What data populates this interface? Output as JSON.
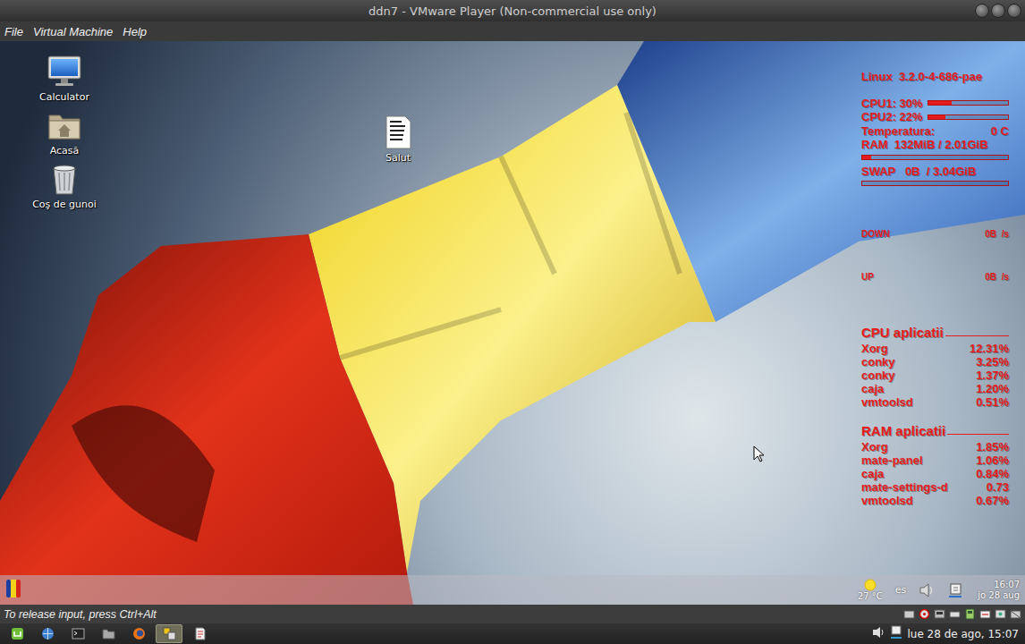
{
  "window": {
    "title": "ddn7 - VMware Player (Non-commercial use only)"
  },
  "menu": [
    "File",
    "Virtual Machine",
    "Help"
  ],
  "desktop_icons": [
    {
      "label": "Calculator"
    },
    {
      "label": "Acasă"
    },
    {
      "label": "Coş de gunoi"
    },
    {
      "label": "Salut"
    }
  ],
  "conky": {
    "kernel": "Linux  3.2.0-4-686-pae",
    "system": [
      {
        "kind": "inline",
        "label": "CPU1: 30%",
        "level": 0.3
      },
      {
        "kind": "inline",
        "label": "CPU2: 22%",
        "level": 0.22
      },
      {
        "kind": "pair",
        "label": "Temperatura:",
        "value": "0 C"
      },
      {
        "kind": "below",
        "label": "RAM  132MiB / 2.01GiB",
        "level": 0.064
      },
      {
        "kind": "below",
        "label": "SWAP   0B  / 3.04GiB",
        "level": 0
      }
    ],
    "network": [
      {
        "label": "DOWN",
        "value": "0B  /s"
      },
      {
        "label": "UP",
        "value": "0B  /s"
      }
    ],
    "cpu_apps": {
      "title": "CPU aplicatii",
      "rows": [
        {
          "name": "Xorg",
          "value": "12.31%"
        },
        {
          "name": "conky",
          "value": "3.25%"
        },
        {
          "name": "conky",
          "value": "1.37%"
        },
        {
          "name": "caja",
          "value": "1.20%"
        },
        {
          "name": "vmtoolsd",
          "value": "0.51%"
        }
      ]
    },
    "ram_apps": {
      "title": "RAM aplicatii",
      "rows": [
        {
          "name": "Xorg",
          "value": "1.85%"
        },
        {
          "name": "mate-panel",
          "value": "1.06%"
        },
        {
          "name": "caja",
          "value": "0.84%"
        },
        {
          "name": "mate-settings-d",
          "value": "0.73"
        },
        {
          "name": "vmtoolsd",
          "value": "0.67%"
        }
      ]
    }
  },
  "guest_panel": {
    "temperature": "27 °C",
    "layout": "es",
    "time": "16:07",
    "date": "jo 28 aug"
  },
  "status_bar": {
    "message": "To release input, press Ctrl+Alt"
  },
  "host_taskbar": {
    "apps": [
      {
        "selected": false
      },
      {
        "selected": false
      },
      {
        "selected": false
      },
      {
        "selected": false
      },
      {
        "selected": false
      },
      {
        "selected": true
      },
      {
        "selected": false
      }
    ],
    "clock": "lue 28 de ago, 15:07"
  }
}
